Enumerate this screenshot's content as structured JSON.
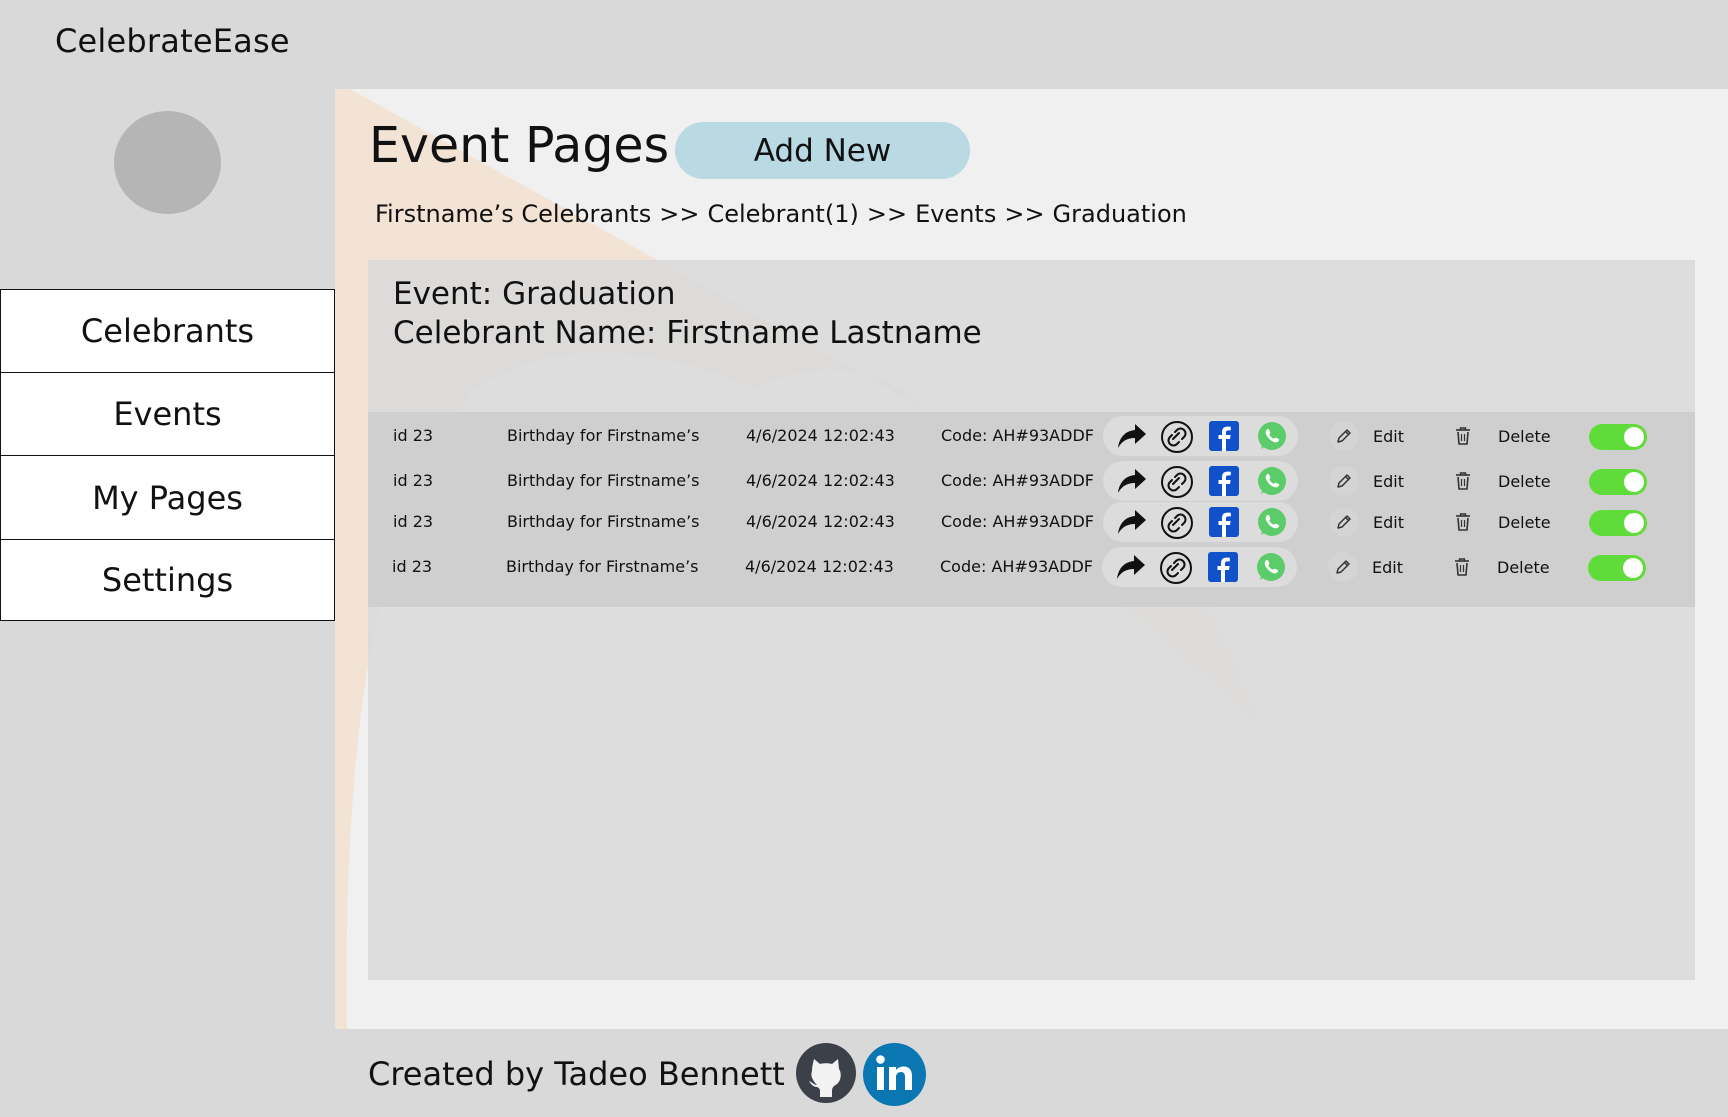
{
  "app": {
    "title": "CelebrateEase"
  },
  "sidebar": {
    "items": [
      {
        "label": "Celebrants"
      },
      {
        "label": "Events"
      },
      {
        "label": "My Pages"
      },
      {
        "label": "Settings"
      }
    ]
  },
  "main": {
    "title": "Event Pages",
    "add_new_label": "Add New",
    "breadcrumb": {
      "items": [
        "Firstname’s Celebrants",
        "Celebrant(1)",
        "Events",
        "Graduation"
      ],
      "separator": ">>"
    },
    "event_line": "Event: Graduation",
    "celebrant_line": "Celebrant Name: Firstname Lastname",
    "rows": [
      {
        "id": "id 23",
        "name": "Birthday for Firstname’s",
        "date": "4/6/2024 12:02:43",
        "code": "Code: AH#93ADDF",
        "edit_label": "Edit",
        "delete_label": "Delete",
        "enabled": true
      },
      {
        "id": "id 23",
        "name": "Birthday for Firstname’s",
        "date": "4/6/2024 12:02:43",
        "code": "Code: AH#93ADDF",
        "edit_label": "Edit",
        "delete_label": "Delete",
        "enabled": true
      },
      {
        "id": "id 23",
        "name": "Birthday for Firstname’s",
        "date": "4/6/2024 12:02:43",
        "code": "Code: AH#93ADDF",
        "edit_label": "Edit",
        "delete_label": "Delete",
        "enabled": true
      },
      {
        "id": "id 23",
        "name": "Birthday for Firstname’s",
        "date": "4/6/2024 12:02:43",
        "code": "Code: AH#93ADDF",
        "edit_label": "Edit",
        "delete_label": "Delete",
        "enabled": true
      }
    ],
    "row_icons": [
      "share-arrow-icon",
      "link-icon",
      "facebook-icon",
      "whatsapp-icon",
      "pencil-icon",
      "trash-icon"
    ]
  },
  "footer": {
    "credit": "Created by Tadeo Bennett",
    "icons": [
      "github-icon",
      "linkedin-icon"
    ]
  },
  "colors": {
    "background": "#d9d9d9",
    "main_panel": "#f0f0f0",
    "add_button": "#b9d9e3",
    "toggle_on": "#5fdc3a",
    "facebook": "#1151c9",
    "whatsapp": "#5ccc6a",
    "linkedin": "#0a76b2",
    "github": "#3b4049",
    "avatar": "#b5b5b5"
  }
}
